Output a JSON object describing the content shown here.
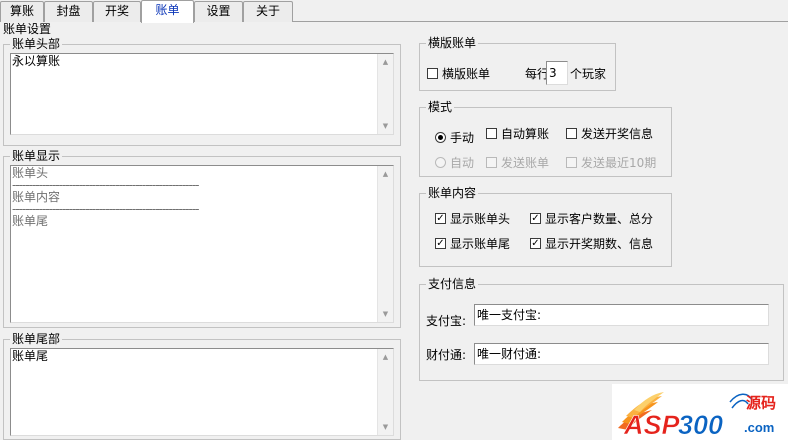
{
  "tabs": [
    {
      "label": "算账"
    },
    {
      "label": "封盘"
    },
    {
      "label": "开奖"
    },
    {
      "label": "账单"
    },
    {
      "label": "设置"
    },
    {
      "label": "关于"
    }
  ],
  "section_title": "账单设置",
  "header_group": {
    "label": "账单头部",
    "text": "永以算账"
  },
  "display_group": {
    "label": "账单显示",
    "lines": [
      "账单头",
      "账单内容",
      "账单尾"
    ],
    "separator": "--------------------------------------------------------"
  },
  "footer_group": {
    "label": "账单尾部",
    "text": "账单尾"
  },
  "horizontal_group": {
    "label": "横版账单",
    "checkbox_label": "横版账单",
    "per_row_label": "每行:",
    "per_row_value": "3",
    "unit_label": "个玩家",
    "checked": false
  },
  "mode_group": {
    "label": "模式",
    "manual": {
      "label": "手动",
      "selected": true
    },
    "auto_calc": {
      "label": "自动算账",
      "checked": false
    },
    "send_lottery": {
      "label": "发送开奖信息",
      "checked": false
    },
    "auto": {
      "label": "自动",
      "selected": false
    },
    "send_bill": {
      "label": "发送账单",
      "checked": false
    },
    "send_recent": {
      "label": "发送最近10期",
      "checked": false
    }
  },
  "content_group": {
    "label": "账单内容",
    "show_header": {
      "label": "显示账单头",
      "checked": true
    },
    "show_customers": {
      "label": "显示客户数量、总分",
      "checked": true
    },
    "show_footer": {
      "label": "显示账单尾",
      "checked": true
    },
    "show_lottery": {
      "label": "显示开奖期数、信息",
      "checked": true
    }
  },
  "payment_group": {
    "label": "支付信息",
    "alipay_label": "支付宝:",
    "alipay_value": "唯一支付宝:",
    "tenpay_label": "财付通:",
    "tenpay_value": "唯一财付通:"
  },
  "watermark": {
    "brand": "ASP300",
    "suffix": "源码",
    "domain": ".com"
  }
}
